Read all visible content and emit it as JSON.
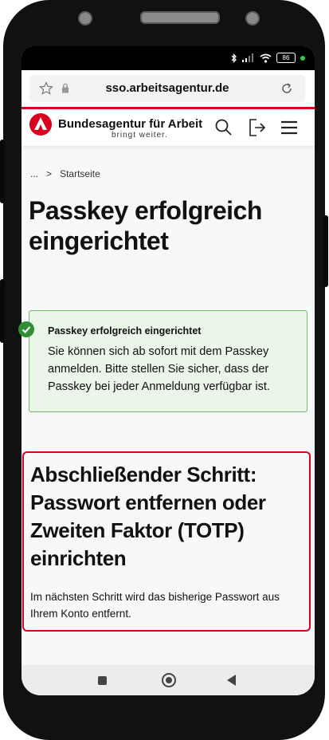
{
  "browser": {
    "url": "sso.arbeitsagentur.de",
    "battery": "86"
  },
  "header": {
    "brand": "Bundesagentur für Arbeit",
    "tagline": "bringt weiter."
  },
  "breadcrumb": {
    "ellipsis": "...",
    "separator": ">",
    "current": "Startseite"
  },
  "page": {
    "title": "Passkey erfolgreich eingerichtet"
  },
  "alert": {
    "title": "Passkey erfolgreich eingerichtet",
    "text": "Sie können sich ab sofort mit dem Passkey anmelden. Bitte stellen Sie sicher, dass der Passkey bei jeder Anmeldung verfügbar ist."
  },
  "final_step": {
    "title": "Abschließender Schritt: Passwort entfernen oder Zweiten Faktor (TOTP) einrichten",
    "text": "Im nächsten Schritt wird das bisherige Passwort aus Ihrem Konto entfernt."
  },
  "icons": {
    "star": "star-icon",
    "lock": "lock-icon",
    "reload": "reload-icon",
    "search": "search-icon",
    "logout": "logout-icon",
    "menu": "menu-icon",
    "check": "check-icon",
    "bluetooth": "bluetooth-icon",
    "signal": "signal-icon",
    "wifi": "wifi-icon"
  },
  "colors": {
    "brand_red": "#d9001f",
    "success_bg": "#eaf6e8",
    "success_border": "#74b869",
    "check_green": "#2f8f34"
  }
}
